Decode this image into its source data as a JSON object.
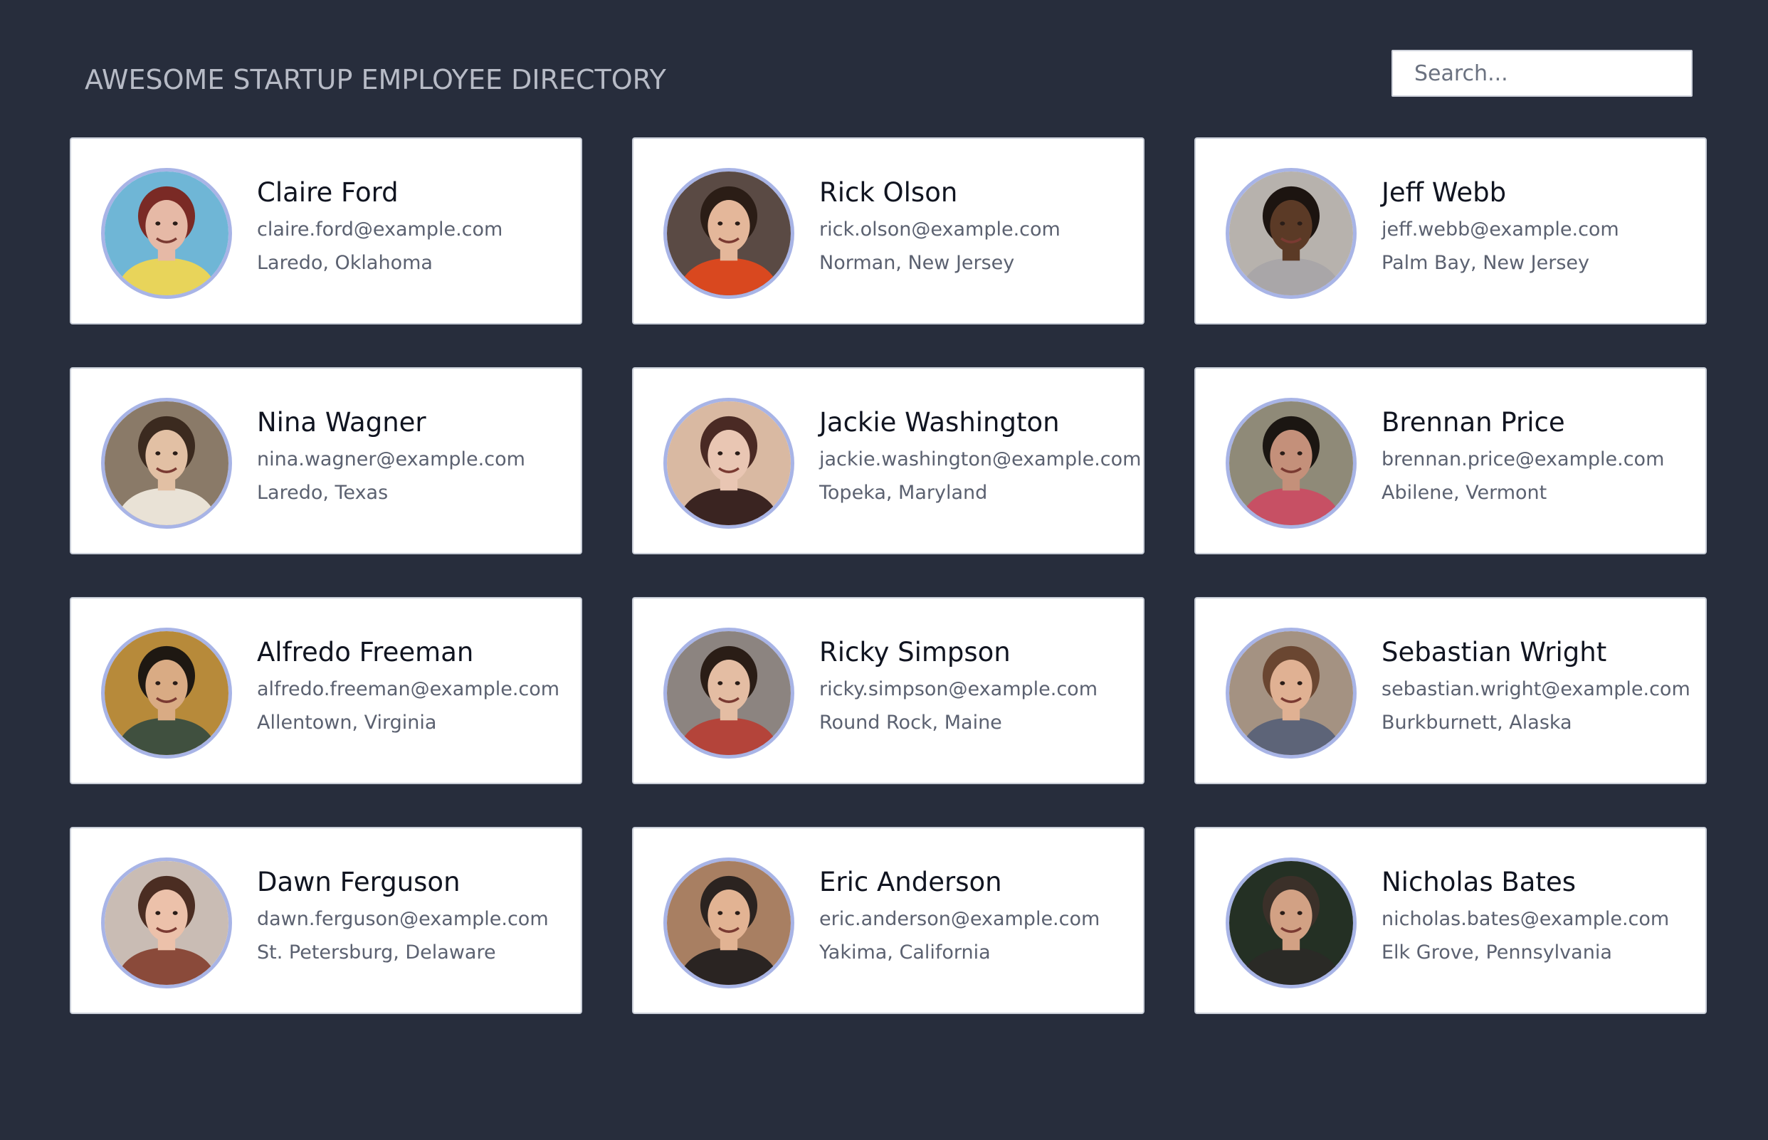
{
  "header": {
    "title": "AWESOME STARTUP EMPLOYEE DIRECTORY",
    "search_placeholder": "Search...",
    "search_value": ""
  },
  "colors": {
    "background": "#272d3c",
    "card": "#ffffff",
    "avatar_ring": "#a8b4e6",
    "title": "#b7bbc6",
    "name": "#101420",
    "secondary_text": "#5b6170"
  },
  "employees": [
    {
      "name": "Claire Ford",
      "email": "claire.ford@example.com",
      "location": "Laredo, Oklahoma",
      "avatar": {
        "bg": "#6fb6d6",
        "hair": "#7a2a25",
        "skin": "#e6b9a6",
        "shirt": "#e8d45a"
      }
    },
    {
      "name": "Rick Olson",
      "email": "rick.olson@example.com",
      "location": "Norman, New Jersey",
      "avatar": {
        "bg": "#5a4a44",
        "hair": "#2b1d16",
        "skin": "#e4b79a",
        "shirt": "#d9481f"
      }
    },
    {
      "name": "Jeff Webb",
      "email": "jeff.webb@example.com",
      "location": "Palm Bay, New Jersey",
      "avatar": {
        "bg": "#b7b2ad",
        "hair": "#1c1410",
        "skin": "#5b3a26",
        "shirt": "#a9a6a8"
      }
    },
    {
      "name": "Nina Wagner",
      "email": "nina.wagner@example.com",
      "location": "Laredo, Texas",
      "avatar": {
        "bg": "#8a7a68",
        "hair": "#3b2a1f",
        "skin": "#e2c0a4",
        "shirt": "#e9e2d6"
      }
    },
    {
      "name": "Jackie Washington",
      "email": "jackie.washington@example.com",
      "location": "Topeka, Maryland",
      "avatar": {
        "bg": "#d9b9a2",
        "hair": "#4a2a24",
        "skin": "#e9c6b3",
        "shirt": "#3a2421"
      }
    },
    {
      "name": "Brennan Price",
      "email": "brennan.price@example.com",
      "location": "Abilene, Vermont",
      "avatar": {
        "bg": "#8f8a78",
        "hair": "#1b1612",
        "skin": "#c4907a",
        "shirt": "#c75064"
      }
    },
    {
      "name": "Alfredo Freeman",
      "email": "alfredo.freeman@example.com",
      "location": "Allentown, Virginia",
      "avatar": {
        "bg": "#b78a3a",
        "hair": "#1e1812",
        "skin": "#d9ab84",
        "shirt": "#40503f"
      }
    },
    {
      "name": "Ricky Simpson",
      "email": "ricky.simpson@example.com",
      "location": "Round Rock, Maine",
      "avatar": {
        "bg": "#8c8480",
        "hair": "#2a1d16",
        "skin": "#e4bda3",
        "shirt": "#b4443a"
      }
    },
    {
      "name": "Sebastian Wright",
      "email": "sebastian.wright@example.com",
      "location": "Burkburnett, Alaska",
      "avatar": {
        "bg": "#a49282",
        "hair": "#6a4631",
        "skin": "#e0b193",
        "shirt": "#5d6478"
      }
    },
    {
      "name": "Dawn Ferguson",
      "email": "dawn.ferguson@example.com",
      "location": "St. Petersburg, Delaware",
      "avatar": {
        "bg": "#c9bcb4",
        "hair": "#4b2d22",
        "skin": "#ecc1aa",
        "shirt": "#8a4a3a"
      }
    },
    {
      "name": "Eric Anderson",
      "email": "eric.anderson@example.com",
      "location": "Yakima, California",
      "avatar": {
        "bg": "#a87f62",
        "hair": "#2b2320",
        "skin": "#e2b393",
        "shirt": "#2a2422"
      }
    },
    {
      "name": "Nicholas Bates",
      "email": "nicholas.bates@example.com",
      "location": "Elk Grove, Pennsylvania",
      "avatar": {
        "bg": "#243024",
        "hair": "#3b3029",
        "skin": "#d2a184",
        "shirt": "#2a2a26"
      }
    }
  ]
}
